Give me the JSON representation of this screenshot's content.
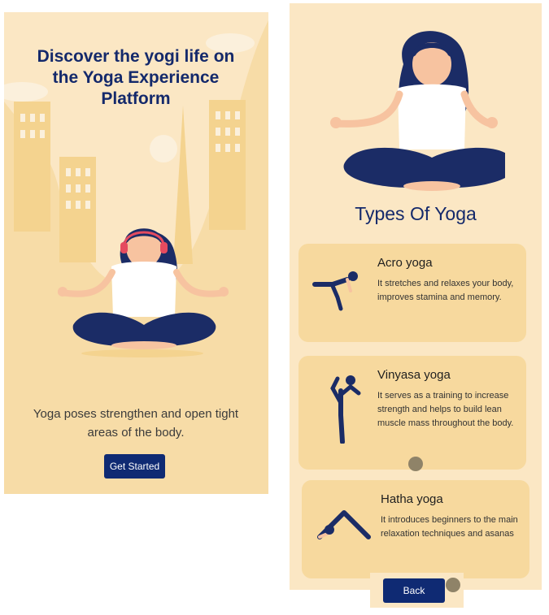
{
  "colors": {
    "background": "#fbe7c4",
    "card": "#f7d99e",
    "primary": "#0f2a73",
    "heading": "#14296b"
  },
  "welcome": {
    "title": "Discover the yogi life on the Yoga Experience Platform",
    "tagline": "Yoga poses strengthen and open tight areas of the body.",
    "cta_label": "Get Started"
  },
  "types": {
    "title": "Types Of Yoga",
    "items": [
      {
        "name": "Acro yoga",
        "description": "It stretches and relaxes your body, improves stamina and memory.",
        "icon": "acro-pose-figure"
      },
      {
        "name": "Vinyasa yoga",
        "description": "It serves as a training to increase strength and helps to build lean muscle mass throughout the body.",
        "icon": "vinyasa-pose-figure"
      },
      {
        "name": "Hatha yoga",
        "description": "It introduces beginners to the main relaxation techniques and asanas",
        "icon": "downward-dog-figure"
      }
    ],
    "back_label": "Back"
  }
}
